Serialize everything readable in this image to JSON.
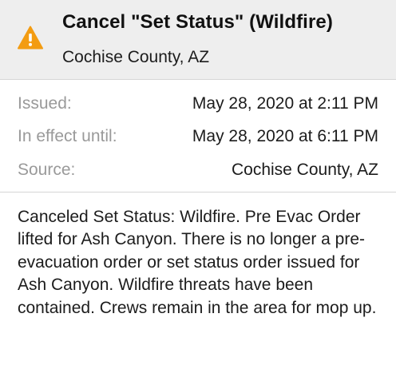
{
  "alert": {
    "icon": "warning-icon",
    "icon_color": "#f39c12",
    "title": "Cancel \"Set Status\" (Wildfire)",
    "area": "Cochise County, AZ"
  },
  "details": {
    "issued": {
      "label": "Issued:",
      "value": "May 28, 2020 at 2:11 PM"
    },
    "in_effect_until": {
      "label": "In effect until:",
      "value": "May 28, 2020 at 6:11 PM"
    },
    "source": {
      "label": "Source:",
      "value": "Cochise County, AZ"
    }
  },
  "description": "Canceled Set Status: Wildfire. Pre Evac Order lifted for Ash Canyon. There is no longer a pre-evacuation order or set status order issued for Ash Canyon. Wildfire threats have been contained. Crews remain in the area for mop up."
}
